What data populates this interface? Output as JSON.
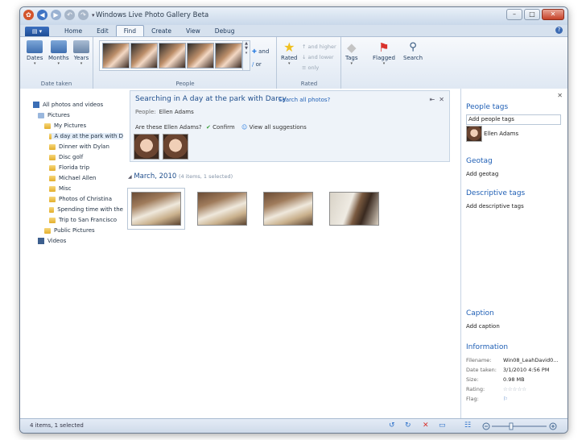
{
  "window": {
    "title": "Windows Live Photo Gallery Beta"
  },
  "ribbon": {
    "tabs": [
      "Home",
      "Edit",
      "Find",
      "Create",
      "View",
      "Debug"
    ],
    "date_group": {
      "label": "Date taken",
      "buttons": [
        "Dates",
        "Months",
        "Years"
      ]
    },
    "people_group": {
      "label": "People",
      "and": "and",
      "or": "or"
    },
    "rated_group": {
      "label": "Rated",
      "button": "Rated",
      "and_higher": "and higher",
      "and_lower": "and lower",
      "only": "only"
    },
    "tags": "Tags",
    "flagged": "Flagged",
    "search": "Search"
  },
  "nav": {
    "items": [
      "All photos and videos",
      "Pictures",
      "My Pictures",
      "A day at the park with D",
      "Dinner with Dylan",
      "Disc golf",
      "Florida trip",
      "Michael Allen",
      "Misc",
      "Photos of Christina",
      "Spending time with the",
      "Trip to San Francisco",
      "Public Pictures",
      "Videos"
    ]
  },
  "search_bar": {
    "title": "Searching in A day at the park with Darcy",
    "search_all": "Search all photos?",
    "people_label": "People:",
    "people_value": "Ellen Adams",
    "question": "Are these Ellen Adams?",
    "confirm": "Confirm",
    "view_all": "View all suggestions"
  },
  "gallery": {
    "group_title": "March, 2010",
    "group_count": "(4 items, 1 selected)"
  },
  "details": {
    "people_tags": "People tags",
    "add_people_tags": "Add people tags",
    "person": "Ellen Adams",
    "geotag": "Geotag",
    "add_geotag": "Add geotag",
    "descriptive_tags": "Descriptive tags",
    "add_descriptive_tags": "Add descriptive tags",
    "caption": "Caption",
    "add_caption": "Add caption",
    "information": "Information",
    "info": [
      {
        "label": "Filename:",
        "value": "Win08_LeahDavid0..."
      },
      {
        "label": "Date taken:",
        "value": "3/1/2010  4:56 PM"
      },
      {
        "label": "Size:",
        "value": "0.98 MB"
      },
      {
        "label": "Rating:",
        "value": "☆☆☆☆☆"
      },
      {
        "label": "Flag:",
        "value": "⚐"
      }
    ]
  },
  "status": {
    "text": "4 items, 1 selected"
  }
}
